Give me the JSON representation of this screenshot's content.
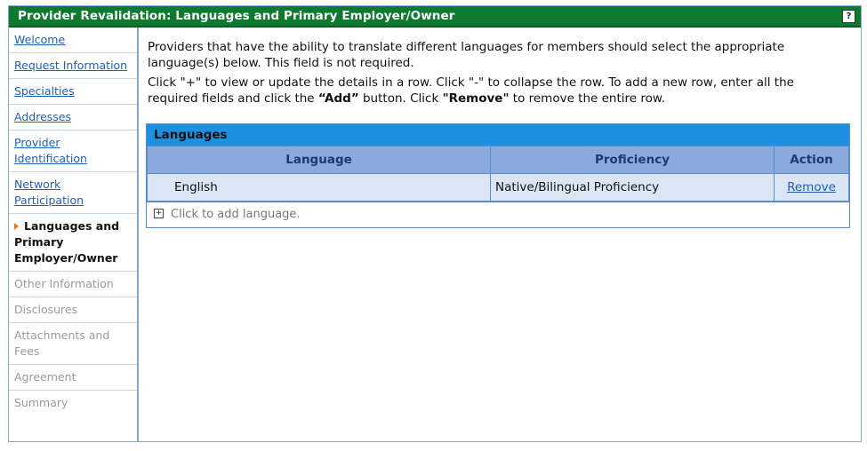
{
  "header": {
    "title": "Provider Revalidation: Languages and Primary Employer/Owner",
    "help_label": "?"
  },
  "sidebar": {
    "items": [
      {
        "label": "Welcome",
        "state": "link"
      },
      {
        "label": "Request Information",
        "state": "link"
      },
      {
        "label": "Specialties",
        "state": "link"
      },
      {
        "label": "Addresses",
        "state": "link"
      },
      {
        "label": "Provider Identification",
        "state": "link"
      },
      {
        "label": "Network Participation",
        "state": "link"
      },
      {
        "label": "Languages and Primary Employer/Owner",
        "state": "current"
      },
      {
        "label": "Other Information",
        "state": "disabled"
      },
      {
        "label": "Disclosures",
        "state": "disabled"
      },
      {
        "label": "Attachments and Fees",
        "state": "disabled"
      },
      {
        "label": "Agreement",
        "state": "disabled"
      },
      {
        "label": "Summary",
        "state": "disabled"
      }
    ]
  },
  "main": {
    "intro1": "Providers that have the ability to translate different languages for members should select the appropriate language(s) below. This field is not required.",
    "intro2_a": "Click \"+\" to view or update the details in a row. Click \"-\" to collapse the row. To add a new row, enter all the required fields and click the ",
    "intro2_add": "“Add”",
    "intro2_b": " button. Click ",
    "intro2_remove": "\"Remove\"",
    "intro2_c": " to remove the entire row.",
    "panel_title": "Languages",
    "columns": {
      "language": "Language",
      "proficiency": "Proficiency",
      "action": "Action"
    },
    "rows": [
      {
        "language": "English",
        "proficiency": "Native/Bilingual Proficiency",
        "action": "Remove"
      }
    ],
    "add_label": "Click to add language.",
    "add_icon": "+"
  },
  "colors": {
    "titlebar": "#0e7a2f",
    "panel_header": "#1e90e0",
    "column_header": "#8aaade",
    "row": "#dbe5f3",
    "link": "#1f5fb8",
    "current_arrow": "#e8791c"
  }
}
